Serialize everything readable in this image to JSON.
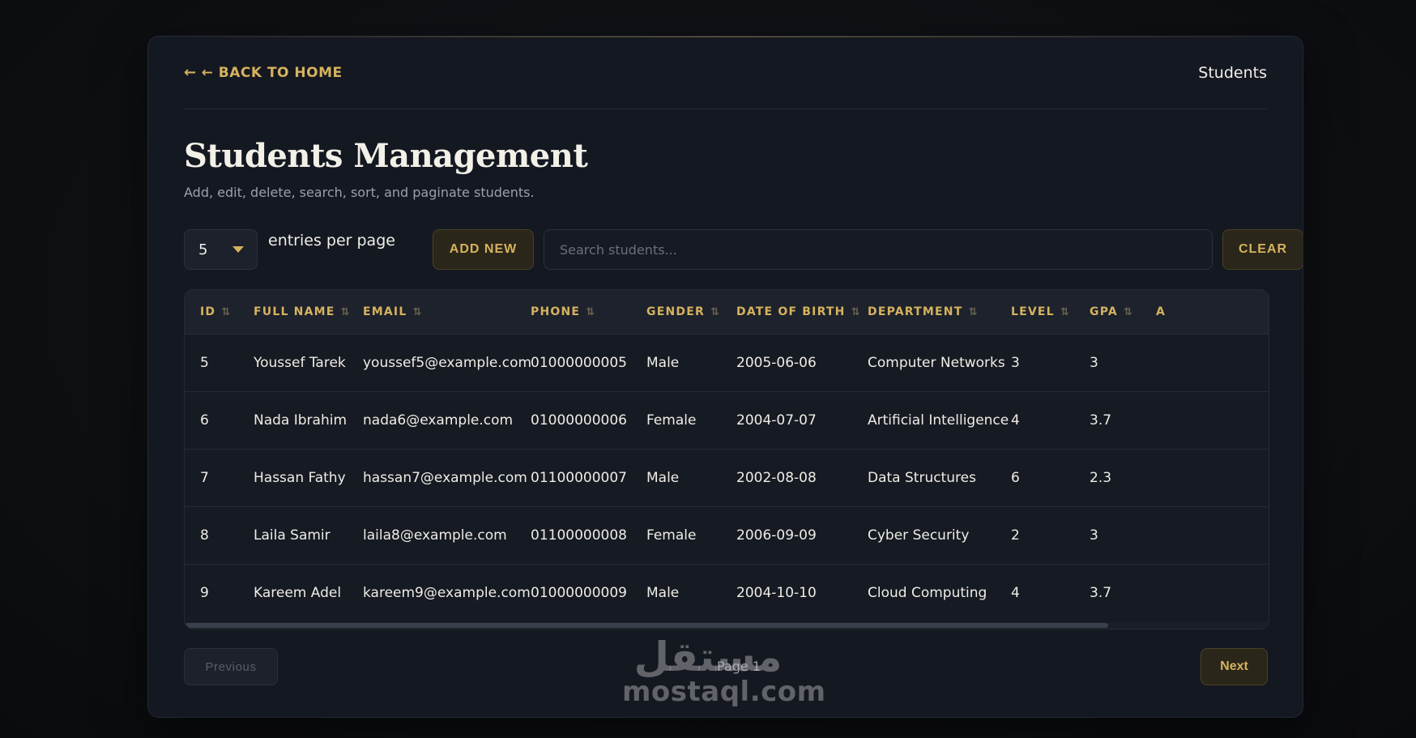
{
  "header": {
    "back_label": "← BACK TO HOME",
    "breadcrumb": "Students"
  },
  "page": {
    "title": "Students Management",
    "subtitle": "Add, edit, delete, search, sort, and paginate students."
  },
  "controls": {
    "entries_value": "5",
    "entries_label": "entries per page",
    "add_label": "ADD NEW",
    "search_placeholder": "Search students...",
    "search_value": "",
    "clear_label": "CLEAR"
  },
  "table": {
    "columns": [
      "ID",
      "FULL NAME",
      "EMAIL",
      "PHONE",
      "GENDER",
      "DATE OF BIRTH",
      "DEPARTMENT",
      "LEVEL",
      "GPA",
      "A"
    ],
    "sort_icon": "⇅",
    "rows": [
      [
        "5",
        "Youssef Tarek",
        "youssef5@example.com",
        "01000000005",
        "Male",
        "2005-06-06",
        "Computer Networks",
        "3",
        "3"
      ],
      [
        "6",
        "Nada Ibrahim",
        "nada6@example.com",
        "01000000006",
        "Female",
        "2004-07-07",
        "Artificial Intelligence",
        "4",
        "3.7"
      ],
      [
        "7",
        "Hassan Fathy",
        "hassan7@example.com",
        "01100000007",
        "Male",
        "2002-08-08",
        "Data Structures",
        "6",
        "2.3"
      ],
      [
        "8",
        "Laila Samir",
        "laila8@example.com",
        "01100000008",
        "Female",
        "2006-09-09",
        "Cyber Security",
        "2",
        "3"
      ],
      [
        "9",
        "Kareem Adel",
        "kareem9@example.com",
        "01000000009",
        "Male",
        "2004-10-10",
        "Cloud Computing",
        "4",
        "3.7"
      ]
    ]
  },
  "pagination": {
    "prev_label": "Previous",
    "page_label": "Page 1",
    "next_label": "Next"
  },
  "watermark": {
    "arabic": "مستقل",
    "latin": "mostaql.com"
  },
  "colors": {
    "accent": "#d6b25e",
    "card": "#141821",
    "background": "#0e1014"
  }
}
